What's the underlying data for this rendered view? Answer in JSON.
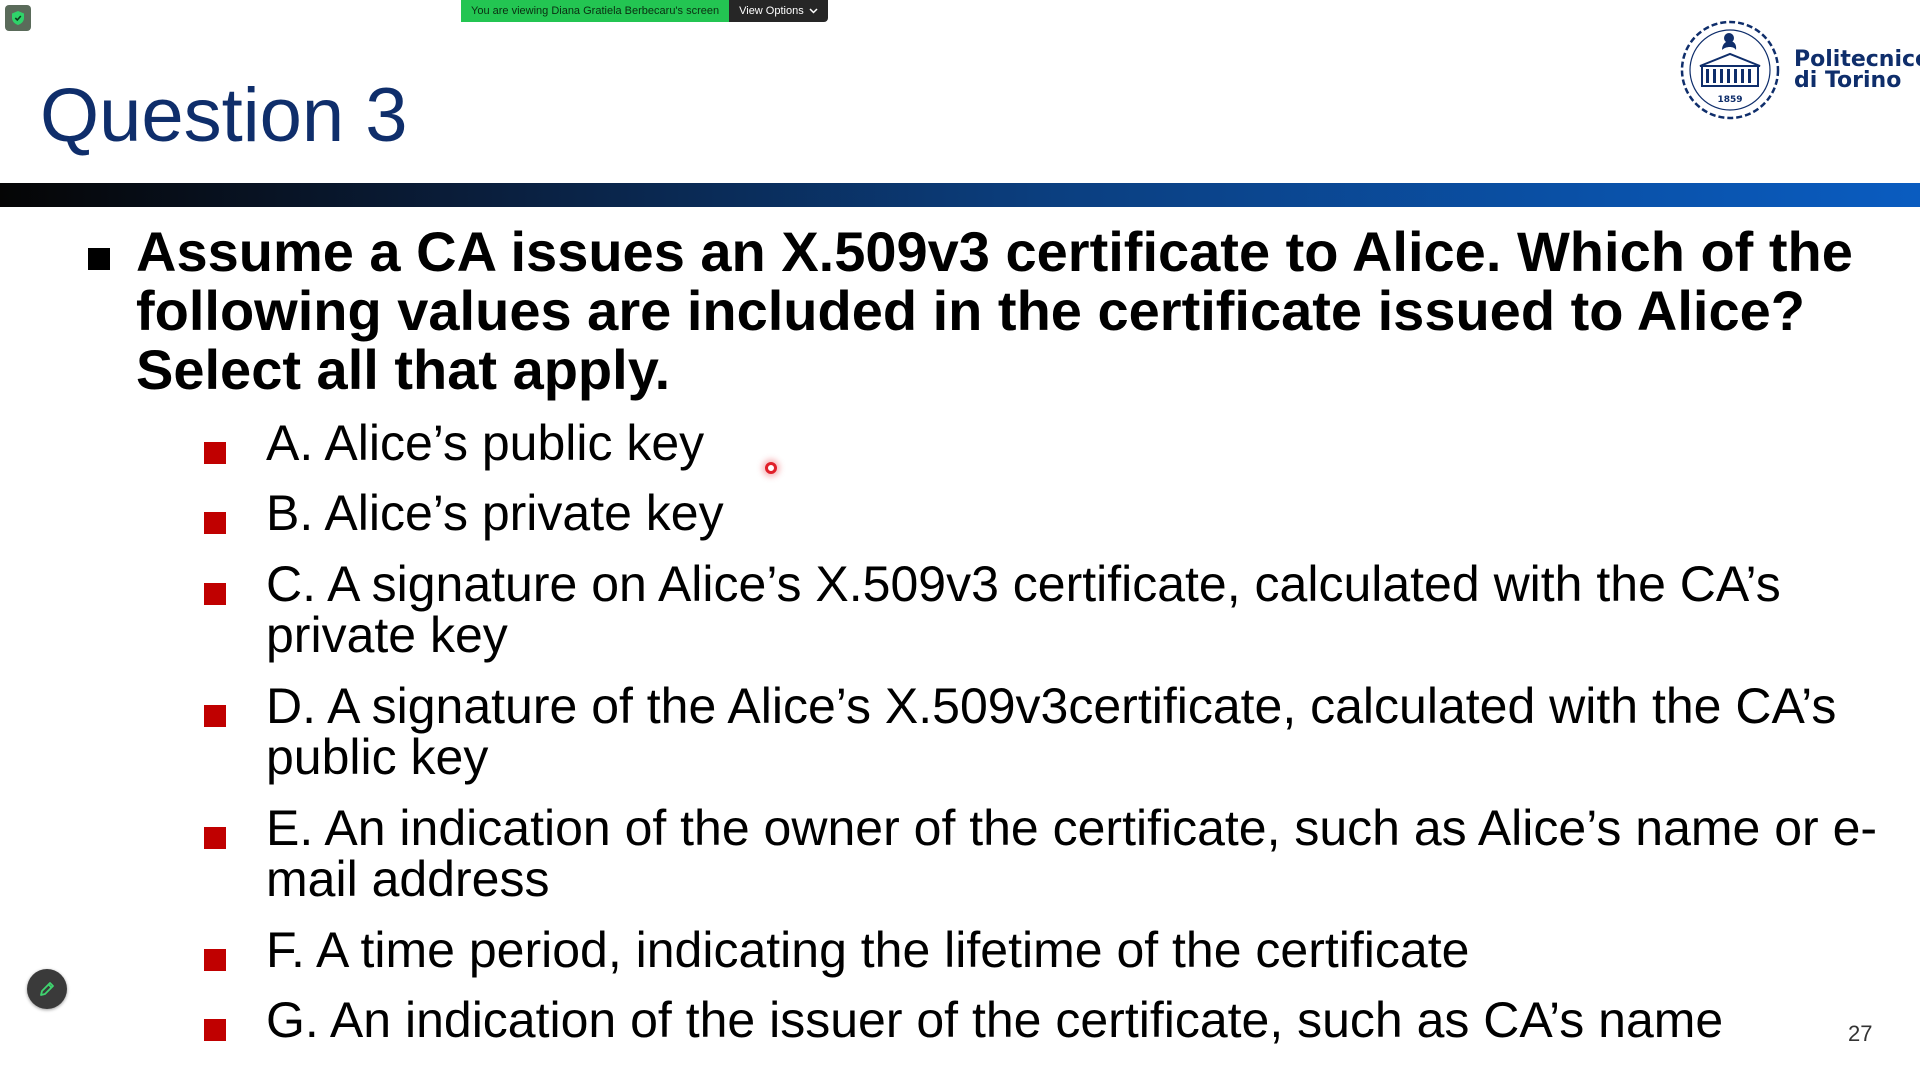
{
  "share_banner": {
    "viewing_text": "You are viewing Diana Gratiela Berbecaru's screen",
    "view_options_label": "View Options"
  },
  "slide": {
    "title": "Question 3",
    "logo_line1": "Politecnico",
    "logo_line2": "di Torino",
    "logo_year": "1859",
    "question": "Assume a CA issues an X.509v3 certificate to Alice. Which of the following values are included in the certificate issued to Alice? Select all that apply.",
    "options": [
      "A. Alice’s public key",
      "B. Alice’s private key",
      "C. A signature on Alice’s X.509v3 certificate, calculated with the CA’s private key",
      "D. A signature of the Alice’s X.509v3certificate, calculated with the CA’s public key",
      "E. An indication of the owner of the certificate, such as Alice’s name or e-mail address",
      "F. A time period, indicating the lifetime of the certificate",
      "G. An indication of the issuer of the certificate, such as CA’s name"
    ],
    "slide_number": "27"
  },
  "colors": {
    "title": "#0f2e6b",
    "bullet_question": "#000000",
    "bullet_option": "#c00000",
    "banner_green": "#23c552",
    "banner_dark": "#262626"
  },
  "icons": {
    "shield": "shield-icon",
    "chevron": "chevron-down-icon",
    "pencil": "pencil-icon",
    "laser": "laser-pointer"
  }
}
